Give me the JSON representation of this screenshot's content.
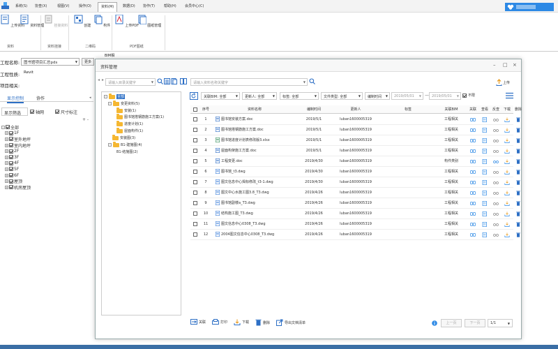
{
  "menu": [
    "系统(S)",
    "协查(X)",
    "视图(V)",
    "操作(O)",
    "资料(M)",
    "数据(D)",
    "协作(T)",
    "帮助(H)",
    "会员中心(C)"
  ],
  "cloud_label": "",
  "ribbon": {
    "buttons": [
      "上传资料",
      "资料管理",
      "挂接资料",
      "创建",
      "构件",
      "上传PDF",
      "图纸管理"
    ],
    "groups": [
      "资料",
      "资料挂接",
      "二维码",
      "PDF图纸"
    ]
  },
  "left_panel": {
    "project_label": "工程名称:",
    "project_value": "图书馆项目汇总pds",
    "more_btn": "更多",
    "nature_label": "工程性质:",
    "nature_value": "Revit",
    "related_label": "项目相关:",
    "bim_label": "BIM相",
    "tabs": [
      "显示控制",
      "协作"
    ],
    "display_filter": "显示筛选",
    "axis_label": "轴网",
    "dim_label": "尺寸标注",
    "floors": [
      "全部",
      "1F",
      "室外地坪",
      "室内地坪",
      "2F",
      "3F",
      "4F",
      "5F",
      "6F",
      "屋顶",
      "机房屋顶"
    ]
  },
  "dialog": {
    "title": "资料管理",
    "tree_search": "请输入目录关键字",
    "file_search": "请输入资料名称关键字",
    "upload": "上传",
    "tree": [
      {
        "label": "全部",
        "level": 0
      },
      {
        "label": "变更资料(5)",
        "level": 1
      },
      {
        "label": "安装(1)",
        "level": 2
      },
      {
        "label": "图书馆搭钢筋施工方案(1)",
        "level": 2
      },
      {
        "label": "进度计划(1)",
        "level": 2
      },
      {
        "label": "屋面构件(1)",
        "level": 2
      },
      {
        "label": "安装图(3)",
        "level": 1
      },
      {
        "label": "B1-建施图(4)",
        "level": 1
      },
      {
        "label": "B1-结施图(2)",
        "level": 2
      }
    ],
    "filters": {
      "bim": "关联BIM: 全部",
      "uploader": "更新人: 全部",
      "tag": "标签: 全部",
      "filetype": "文件类型: 全部",
      "date_mode": "编制时间",
      "date_from": "2019/05/01",
      "date_to": "2019/05/01",
      "unlimited": "不限"
    },
    "columns": [
      "序号",
      "资料名称",
      "编制时间",
      "更新人",
      "标签",
      "关联BIM",
      "关联",
      "查看",
      "反查",
      "下载",
      "删除"
    ],
    "rows": [
      {
        "no": "1",
        "name": "图书馆安装方案.doc",
        "date": "2019/5/1",
        "user": "luban1600005319",
        "bim": "工程相关",
        "type": "doc"
      },
      {
        "no": "2",
        "name": "图书馆搭钢筋施工方案.doc",
        "date": "2019/5/1",
        "user": "luban1600005319",
        "bim": "工程相关",
        "type": "doc"
      },
      {
        "no": "3",
        "name": "图书馆进度计划表修改版3.xlsx",
        "date": "2019/5/1",
        "user": "luban1600005319",
        "bim": "工程相关",
        "type": "xls"
      },
      {
        "no": "4",
        "name": "屋面构架施工方案.doc",
        "date": "2019/5/1",
        "user": "luban1600005319",
        "bim": "工程相关",
        "type": "doc"
      },
      {
        "no": "5",
        "name": "工程变更.doc",
        "date": "2019/4/30",
        "user": "luban1600005319",
        "bim": "构件类别",
        "type": "doc"
      },
      {
        "no": "6",
        "name": "图书馆_t3.dwg",
        "date": "2019/4/30",
        "user": "luban1600005319",
        "bim": "工程相关",
        "type": "dwg"
      },
      {
        "no": "7",
        "name": "图文信息中心揭标修改_t3-1.dwg",
        "date": "2019/4/30",
        "user": "luban1600005319",
        "bim": "工程相关",
        "type": "dwg"
      },
      {
        "no": "8",
        "name": "图文中心水施工图3.8_T3.dwg",
        "date": "2019/4/26",
        "user": "luban1600005319",
        "bim": "工程相关",
        "type": "dwg"
      },
      {
        "no": "9",
        "name": "图书馆副楼a_T3.dwg",
        "date": "2019/4/26",
        "user": "luban1600005319",
        "bim": "工程相关",
        "type": "dwg"
      },
      {
        "no": "10",
        "name": "结构施工图_T3.dwg",
        "date": "2019/4/26",
        "user": "luban1600005319",
        "bim": "工程相关",
        "type": "dwg"
      },
      {
        "no": "11",
        "name": "图文信息中心0308_T3.dwg",
        "date": "2019/4/26",
        "user": "luban1600005319",
        "bim": "工程相关",
        "type": "dwg"
      },
      {
        "no": "12",
        "name": "2004图文信息中心0308_T3.dwg",
        "date": "2019/4/26",
        "user": "luban1600005319",
        "bim": "工程相关",
        "type": "dwg"
      }
    ],
    "bottom": [
      "关联",
      "打印",
      "下载",
      "删除",
      "导出文档清单"
    ],
    "prev": "上一页",
    "next": "下一页",
    "page": "1/1"
  },
  "colors": {
    "accent": "#2d89e5",
    "folder": "#f5b731",
    "doc": "#2b6cc4",
    "dwg": "#3b7dd8",
    "xls": "#2e8b57"
  }
}
